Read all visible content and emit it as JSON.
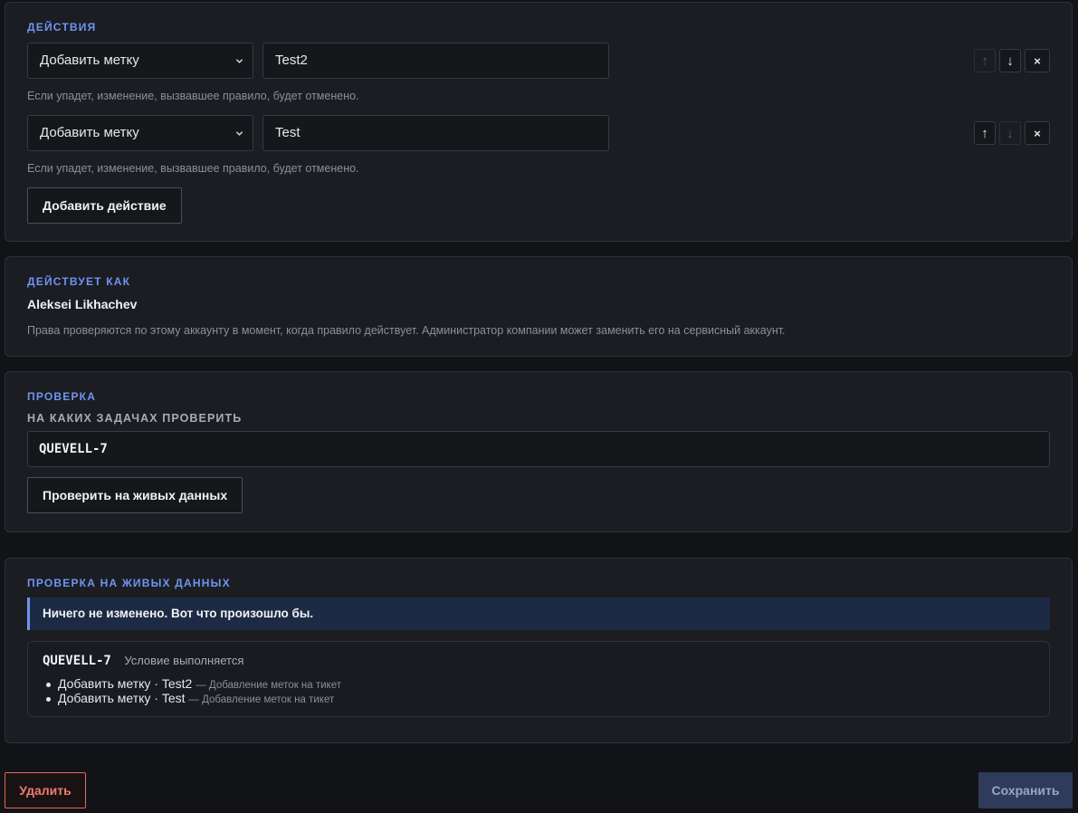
{
  "actions": {
    "title": "ДЕЙСТВИЯ",
    "rows": [
      {
        "action": "Добавить метку",
        "value": "Test2",
        "hint": "Если упадет, изменение, вызвавшее правило, будет отменено.",
        "up": "↑",
        "down": "↓",
        "remove": "×",
        "up_enabled": false,
        "down_enabled": true
      },
      {
        "action": "Добавить метку",
        "value": "Test",
        "hint": "Если упадет, изменение, вызвавшее правило, будет отменено.",
        "up": "↑",
        "down": "↓",
        "remove": "×",
        "up_enabled": true,
        "down_enabled": false
      }
    ],
    "add_button": "Добавить действие"
  },
  "acts_as": {
    "title": "ДЕЙСТВУЕТ КАК",
    "user": "Aleksei Likhachev",
    "description": "Права проверяются по этому аккаунту в момент, когда правило действует. Администратор компании может заменить его на сервисный аккаунт."
  },
  "check": {
    "title": "ПРОВЕРКА",
    "field_label": "НА КАКИХ ЗАДАЧАХ ПРОВЕРИТЬ",
    "field_value": "QUEVELL-7",
    "button": "Проверить на живых данных"
  },
  "live_check": {
    "title": "ПРОВЕРКА НА ЖИВЫХ ДАННЫХ",
    "banner": "Ничего не изменено. Вот что произошло бы.",
    "result": {
      "issue": "QUEVELL-7",
      "status": "Условие выполняется",
      "items": [
        {
          "text": "Добавить метку · Test2",
          "note": "— Добавление меток на тикет"
        },
        {
          "text": "Добавить метку · Test",
          "note": "— Добавление меток на тикет"
        }
      ]
    }
  },
  "footer": {
    "delete": "Удалить",
    "save": "Сохранить"
  },
  "colors": {
    "accent": "#6f95f0",
    "danger": "#e0695a",
    "banner_bg": "#1d2a44",
    "save_bg": "#2f3b5a"
  },
  "icons": {
    "select_chevron": "chevron-down-icon",
    "move_up": "arrow-up-icon",
    "move_down": "arrow-down-icon",
    "remove": "close-icon"
  }
}
